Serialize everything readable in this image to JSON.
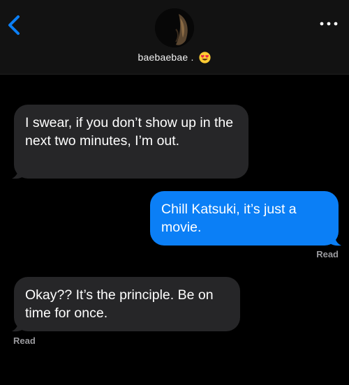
{
  "header": {
    "contact_name": "baebaebae .",
    "contact_emoji": "heart-eyes-emoji",
    "back_icon": "chevron-left-icon",
    "more_icon": "ellipsis-icon",
    "accent_color": "#0b7ff6"
  },
  "messages": [
    {
      "direction": "received",
      "text": "I swear, if you don’t show up in the next two minutes, I’m out."
    },
    {
      "direction": "sent",
      "text": "Chill Katsuki, it’s just a movie."
    },
    {
      "direction": "received",
      "text": "Okay?? It’s the principle. Be on time for once."
    }
  ],
  "receipts": {
    "sent_receipt": "Read",
    "received_receipt": "Read"
  },
  "colors": {
    "background": "#000000",
    "header_bg": "#121212",
    "received_bubble": "#262628",
    "sent_bubble": "#0b7ff6",
    "receipt_text": "#9a9a9e"
  }
}
